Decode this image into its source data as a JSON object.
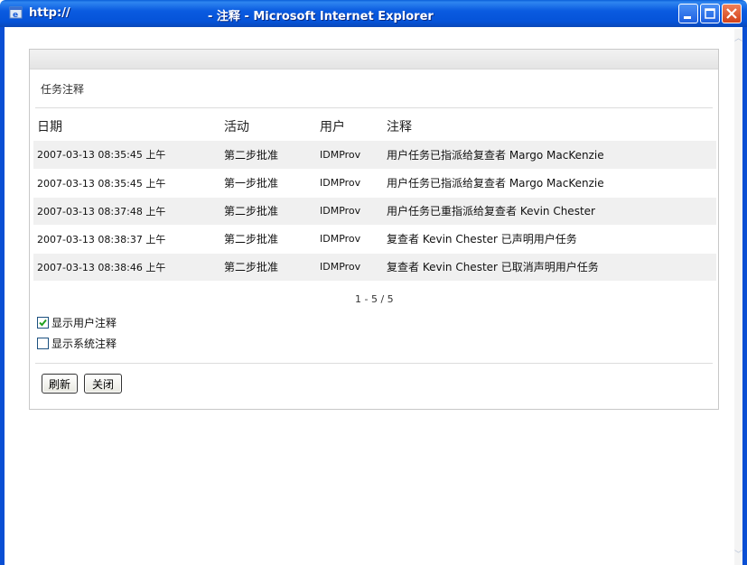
{
  "window": {
    "url": "http://",
    "title": "- 注释 - Microsoft Internet Explorer",
    "icon": "ie-icon",
    "controls": [
      "minimize-icon",
      "maximize-icon",
      "close-icon"
    ]
  },
  "panel": {
    "section_title": "任务注释",
    "columns": {
      "date": "日期",
      "activity": "活动",
      "user": "用户",
      "comment": "注释"
    },
    "rows": [
      {
        "date": "2007-03-13 08:35:45 上午",
        "activity": "第二步批准",
        "user": "IDMProv",
        "comment": "用户任务已指派给复查者 Margo MacKenzie"
      },
      {
        "date": "2007-03-13 08:35:45 上午",
        "activity": "第一步批准",
        "user": "IDMProv",
        "comment": "用户任务已指派给复查者 Margo MacKenzie"
      },
      {
        "date": "2007-03-13 08:37:48 上午",
        "activity": "第二步批准",
        "user": "IDMProv",
        "comment": "用户任务已重指派给复查者 Kevin Chester"
      },
      {
        "date": "2007-03-13 08:38:37 上午",
        "activity": "第二步批准",
        "user": "IDMProv",
        "comment": "复查者 Kevin Chester 已声明用户任务"
      },
      {
        "date": "2007-03-13 08:38:46 上午",
        "activity": "第二步批准",
        "user": "IDMProv",
        "comment": "复查者 Kevin Chester 已取消声明用户任务"
      }
    ],
    "pager": "1 - 5 / 5",
    "options": {
      "show_user_comments": {
        "label": "显示用户注释",
        "checked": true
      },
      "show_system_comments": {
        "label": "显示系统注释",
        "checked": false
      }
    },
    "buttons": {
      "refresh": "刷新",
      "close": "关闭"
    }
  },
  "colors": {
    "titlebar": "#0a5be0",
    "row_shade": "#f0f0f0",
    "close_button": "#d2421a"
  }
}
